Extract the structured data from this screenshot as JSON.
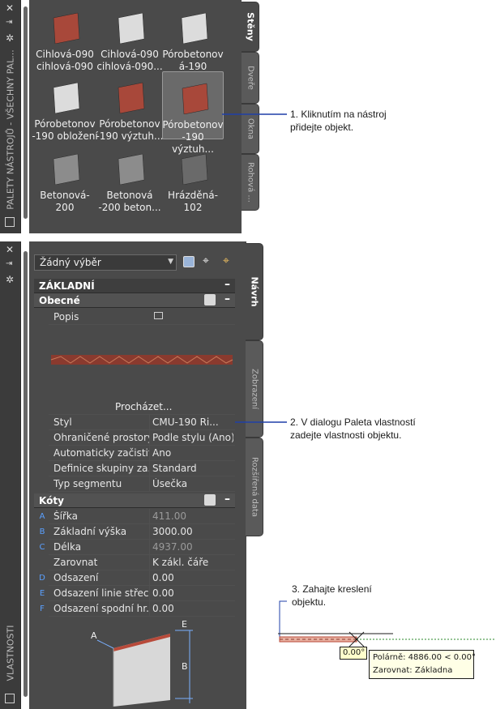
{
  "tool_palette": {
    "title": "PALETY NÁSTROJŮ - VŠECHNY PAL...",
    "tabs": [
      {
        "label": "Stěny",
        "active": true
      },
      {
        "label": "Dveře",
        "active": false
      },
      {
        "label": "Okna",
        "active": false
      },
      {
        "label": "Rohová ...",
        "active": false
      }
    ],
    "tools": [
      {
        "label": "Cihlová-090\ncihlová-090",
        "material": "brick"
      },
      {
        "label": "Cihlová-090\ncihlová-090...",
        "material": "plain"
      },
      {
        "label": "Pórobetonov\ná-190",
        "material": "plain"
      },
      {
        "label": "Pórobetonov\n-190 obložení",
        "material": "plain"
      },
      {
        "label": "Pórobetonov\n-190 výztuh...",
        "material": "brick"
      },
      {
        "label": "Pórobetonov\n-190 výztuh...",
        "material": "brick",
        "selected": true
      },
      {
        "label": "Betonová-\n200",
        "material": "concrete"
      },
      {
        "label": "Betonová\n-200 beton...",
        "material": "concrete"
      },
      {
        "label": "Hrázděná-\n102",
        "material": "dark"
      }
    ]
  },
  "properties": {
    "title": "VLASTNOSTI",
    "selection": "Žádný výběr",
    "tabs": [
      {
        "label": "Návrh",
        "active": true
      },
      {
        "label": "Zobrazení",
        "active": false
      },
      {
        "label": "Rozšířená data",
        "active": false
      }
    ],
    "sections": {
      "basic": "ZÁKLADNÍ",
      "general": "Obecné",
      "dimensions": "Kóty"
    },
    "description_label": "Popis",
    "browse_label": "Procházet...",
    "general_rows": [
      {
        "name": "Styl",
        "value": "CMU-190 Ri..."
      },
      {
        "name": "Ohraničené prostory",
        "value": "Podle stylu (Ano)"
      },
      {
        "name": "Automaticky začistit",
        "value": "Ano"
      },
      {
        "name": "Definice skupiny za...",
        "value": "Standard"
      },
      {
        "name": "Typ segmentu",
        "value": "Úsečka"
      }
    ],
    "dimension_rows": [
      {
        "letter": "A",
        "name": "Šířka",
        "value": "411.00",
        "dim": true
      },
      {
        "letter": "B",
        "name": "Základní výška",
        "value": "3000.00",
        "dim": false
      },
      {
        "letter": "C",
        "name": "Délka",
        "value": "4937.00",
        "dim": true
      },
      {
        "letter": "",
        "name": "Zarovnat",
        "value": "K zákl. čáře",
        "dim": false
      },
      {
        "letter": "D",
        "name": "Odsazení",
        "value": "0.00",
        "dim": false
      },
      {
        "letter": "E",
        "name": "Odsazení linie střec...",
        "value": "0.00",
        "dim": false
      },
      {
        "letter": "F",
        "name": "Odsazení spodní hr...",
        "value": "0.00",
        "dim": false
      }
    ],
    "diagram_letters": [
      "A",
      "B",
      "E"
    ]
  },
  "callouts": {
    "c1": "1. Kliknutím na nástroj\npřidejte objekt.",
    "c2": "2. V dialogu Paleta vlastností\nzadejte vlastnosti objektu.",
    "c3": "3. Zahajte kreslení\nobjektu."
  },
  "drawing": {
    "angle": "0.00°",
    "polar": "Polárně: 4886.00 < 0.00°",
    "justify": "Zarovnat: Základna"
  },
  "colors": {
    "palette_bg": "#4a4a4a",
    "palette_dark": "#2f2f2f",
    "accent_line": "#1f3fa8",
    "brick": "#a8483a",
    "dim_letter": "#5aa0ff"
  }
}
